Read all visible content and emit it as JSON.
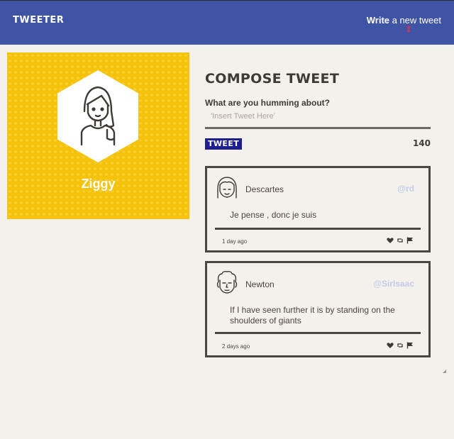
{
  "header": {
    "brand": "TWEETER",
    "write_bold": "Write",
    "write_rest": " a new tweet"
  },
  "profile": {
    "name": "Ziggy",
    "background_color": "#f5c20c"
  },
  "compose": {
    "title": "COMPOSE TWEET",
    "question": "What are you humming about?",
    "placeholder": "'Insert Tweet Here'",
    "button_label": "TWEET",
    "char_count": "140"
  },
  "tweets": [
    {
      "author": "Descartes",
      "handle": "@rd",
      "text": "Je pense , donc je suis",
      "time": "1 day ago"
    },
    {
      "author": "Newton",
      "handle": "@SirIsaac",
      "text": "If I have seen further it is by standing on the shoulders of giants",
      "time": "2 days ago"
    }
  ],
  "icons": {
    "write": "compose-arrows-icon",
    "like": "heart-icon",
    "retweet": "retweet-icon",
    "flag": "flag-icon"
  },
  "colors": {
    "nav": "#4054a6",
    "accent_button": "#1d1e8f",
    "handle": "#c3cde8",
    "write_icon": "#d9304f"
  }
}
